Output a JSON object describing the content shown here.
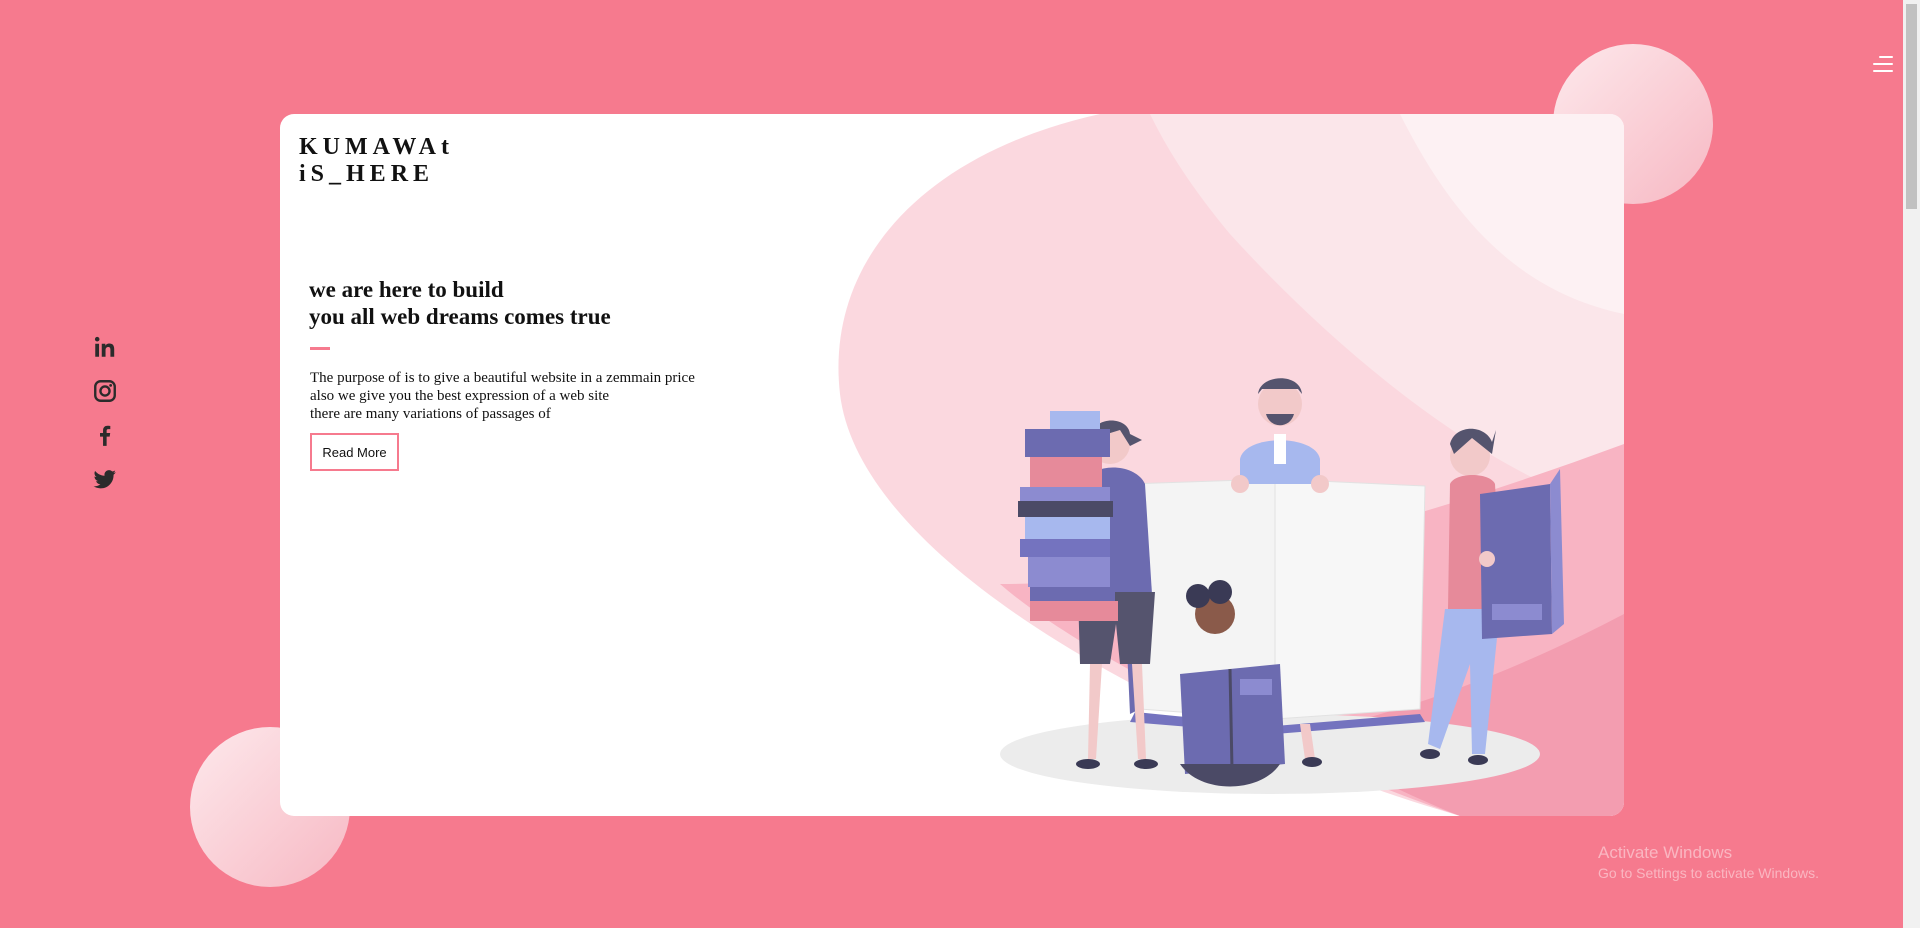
{
  "brand": {
    "line1": "KUMAWAt",
    "line2": "iS_HERE"
  },
  "hero": {
    "headline_line1": "we are here to build",
    "headline_line2": "you all web dreams comes true",
    "desc_line1": "The purpose of is to give a beautiful website in a zemmain price",
    "desc_line2": "also we give you the best expression of a web site",
    "desc_line3": "there are many variations of passages of",
    "button_label": "Read More"
  },
  "social": [
    "linkedin-icon",
    "instagram-icon",
    "facebook-icon",
    "twitter-icon"
  ],
  "watermark": {
    "title": "Activate Windows",
    "subtitle": "Go to Settings to activate Windows."
  },
  "colors": {
    "background": "#f67a8e",
    "accent": "#f67a8e",
    "card": "#ffffff",
    "illustration_purple": "#6c6bb0"
  }
}
